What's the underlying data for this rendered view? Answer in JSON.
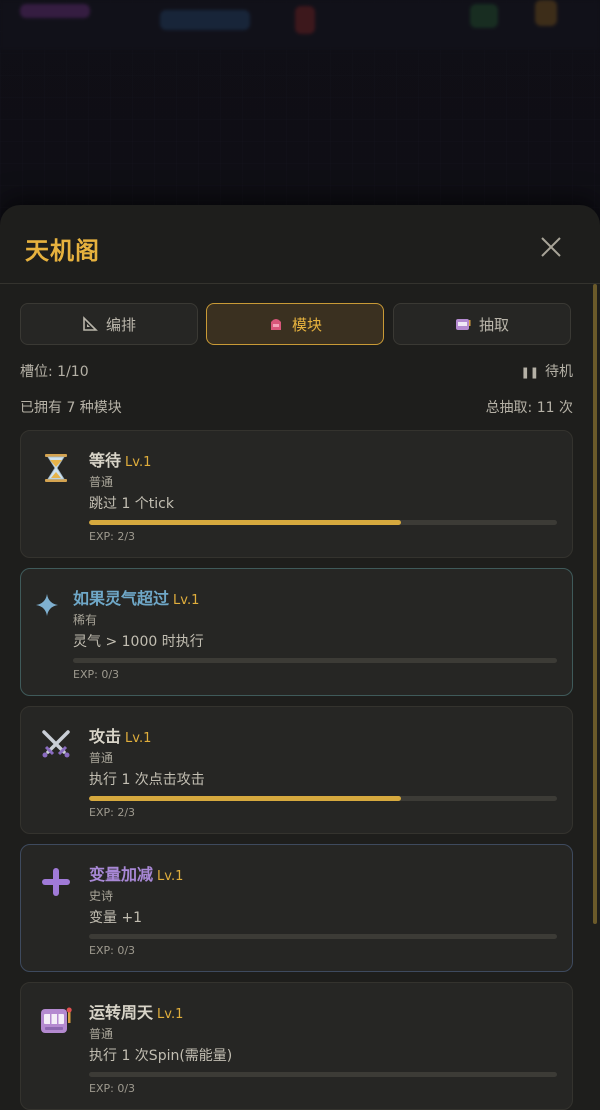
{
  "sheet": {
    "title": "天机阁",
    "close_icon": "close-icon"
  },
  "tabs": [
    {
      "label": "编排",
      "icon": "ruler-triangle-icon",
      "active": false
    },
    {
      "label": "模块",
      "icon": "module-icon",
      "active": true
    },
    {
      "label": "抽取",
      "icon": "slot-machine-icon",
      "active": false
    }
  ],
  "status": {
    "slots": "槽位: 1/10",
    "state": "待机",
    "owned": "已拥有 7 种模块",
    "total_draws": "总抽取: 11 次"
  },
  "modules": [
    {
      "name": "等待",
      "level": "Lv.1",
      "rarity": "普通",
      "desc": "跳过 1 个tick",
      "exp": "EXP: 2/3",
      "progress": 0.667,
      "icon": "hourglass-icon"
    },
    {
      "name": "如果灵气超过",
      "level": "Lv.1",
      "rarity": "稀有",
      "desc": "灵气 > 1000 时执行",
      "exp": "EXP: 0/3",
      "progress": 0,
      "icon": "sparkle-icon"
    },
    {
      "name": "攻击",
      "level": "Lv.1",
      "rarity": "普通",
      "desc": "执行 1 次点击攻击",
      "exp": "EXP: 2/3",
      "progress": 0.667,
      "icon": "crossed-swords-icon"
    },
    {
      "name": "变量加减",
      "level": "Lv.1",
      "rarity": "史诗",
      "desc": "变量 +1",
      "exp": "EXP: 0/3",
      "progress": 0,
      "icon": "plus-icon"
    },
    {
      "name": "运转周天",
      "level": "Lv.1",
      "rarity": "普通",
      "desc": "执行 1 次Spin(需能量)",
      "exp": "EXP: 0/3",
      "progress": 0,
      "icon": "slot-machine-icon"
    }
  ],
  "colors": {
    "accent": "#e7b23e",
    "rare": "#6fa8c8",
    "epic": "#a888d6"
  }
}
